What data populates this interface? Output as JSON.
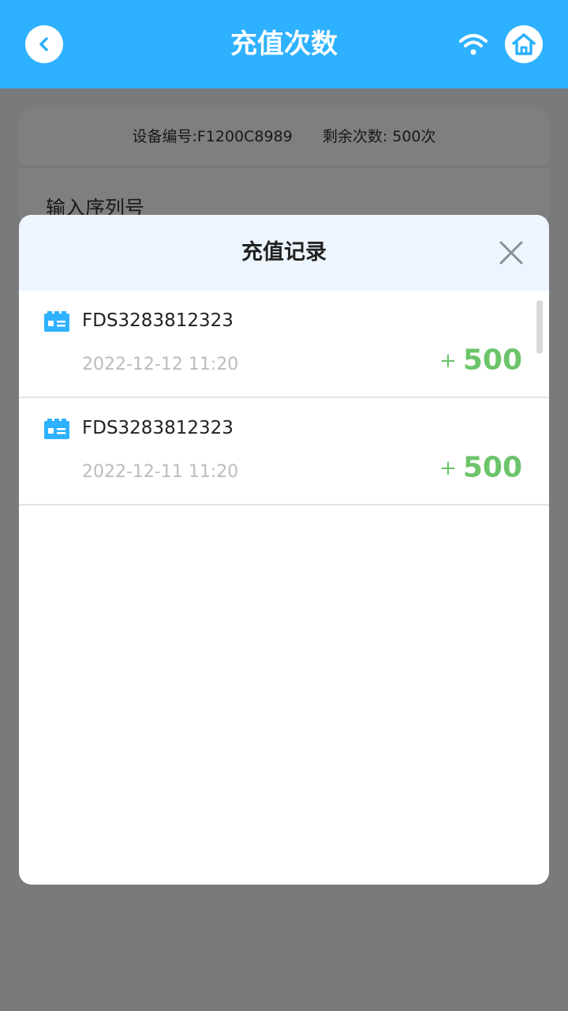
{
  "header": {
    "title": "充值次数",
    "icons": {
      "back": "chevron-left-icon",
      "wifi": "wifi-icon",
      "home": "home-icon"
    }
  },
  "background_card": {
    "device_label": "设备编号:F1200C8989",
    "remaining_label": "剩余次数: 500次",
    "serial_label": "输入序列号"
  },
  "modal": {
    "title": "充值记录",
    "close_icon": "close-icon",
    "records": [
      {
        "code": "FDS3283812323",
        "time": "2022-12-12 11:20",
        "plus": "+",
        "amount": "500"
      },
      {
        "code": "FDS3283812323",
        "time": "2022-12-11 11:20",
        "plus": "+",
        "amount": "500"
      }
    ]
  },
  "colors": {
    "header_bg": "#2eb1ff",
    "modal_header_bg": "#edf5ff",
    "amount_green": "#6cc46a",
    "time_gray": "#bcbcbc",
    "icon_blue": "#2eb1ff"
  }
}
